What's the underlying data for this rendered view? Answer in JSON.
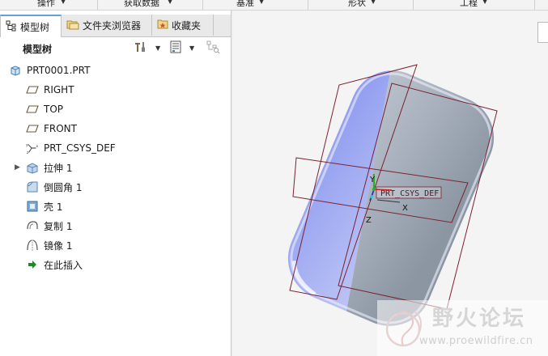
{
  "ribbon": {
    "groups": [
      "操作",
      "获取数据",
      "基准",
      "形状",
      "工程"
    ]
  },
  "tabs": [
    {
      "label": "模型树",
      "icon": "model-tree-icon",
      "active": true
    },
    {
      "label": "文件夹浏览器",
      "icon": "folder-browser-icon",
      "active": false
    },
    {
      "label": "收藏夹",
      "icon": "favorites-icon",
      "active": false
    }
  ],
  "tree_header": {
    "title": "模型树",
    "settings_icon": "tree-settings-icon",
    "columns_icon": "tree-columns-icon",
    "filter_icon": "tree-filter-icon"
  },
  "tree": {
    "items": [
      {
        "label": "PRT0001.PRT",
        "icon": "part-icon"
      },
      {
        "label": "RIGHT",
        "icon": "datum-plane-icon"
      },
      {
        "label": "TOP",
        "icon": "datum-plane-icon"
      },
      {
        "label": "FRONT",
        "icon": "datum-plane-icon"
      },
      {
        "label": "PRT_CSYS_DEF",
        "icon": "coordinate-system-icon"
      },
      {
        "label": "拉伸 1",
        "icon": "extrude-icon",
        "expandable": true
      },
      {
        "label": "倒圆角 1",
        "icon": "round-icon"
      },
      {
        "label": "壳 1",
        "icon": "shell-icon"
      },
      {
        "label": "复制 1",
        "icon": "copy-icon"
      },
      {
        "label": "镜像 1",
        "icon": "mirror-icon"
      },
      {
        "label": "在此插入",
        "icon": "insert-here-arrow-icon"
      }
    ]
  },
  "graphics": {
    "csys_label": "PRT_CSYS_DEF",
    "axis_x": "X",
    "axis_y": "Y",
    "axis_z": "Z",
    "part_color_left": "#a9b4f2",
    "part_color_right": "#aab3bf",
    "datum_color": "#7a2330"
  },
  "watermark": {
    "title": "野火论坛",
    "url": "www.proewildfire.cn"
  }
}
